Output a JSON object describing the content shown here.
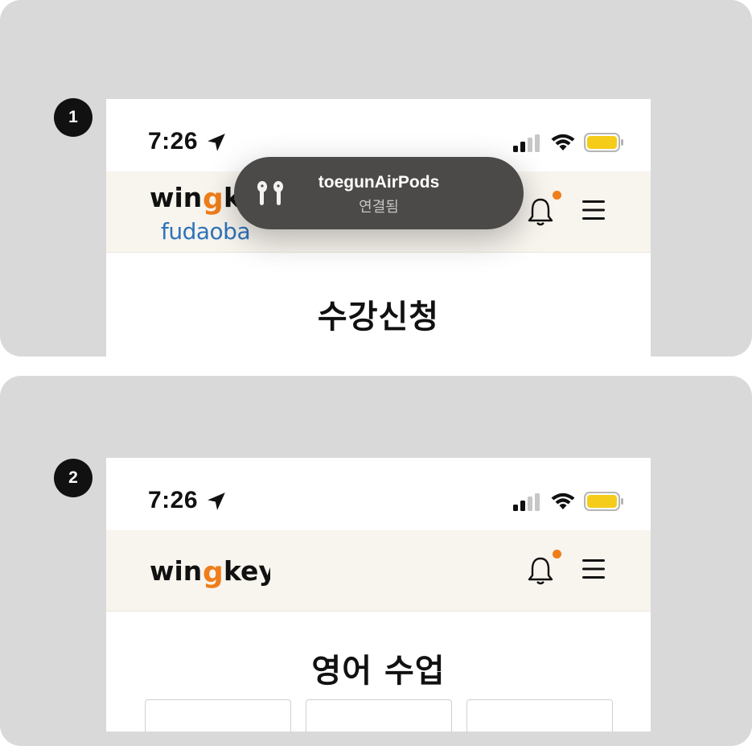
{
  "panel1": {
    "step": "1",
    "status": {
      "time": "7:26"
    },
    "partner_logo": "fudaoba",
    "page_title": "수강신청",
    "popup": {
      "device": "toegunAirPods",
      "status": "연결됨"
    }
  },
  "panel2": {
    "step": "2",
    "status": {
      "time": "7:26"
    },
    "page_title": "영어 수업"
  },
  "brand": {
    "logo_text": "wingkey",
    "accent": "#ef7d1a",
    "header_bg": "#f8f4ee",
    "partner_color": "#2f73b9"
  },
  "icons": [
    "location-arrow-icon",
    "signal-icon",
    "wifi-icon",
    "battery-icon",
    "bell-icon",
    "hamburger-menu-icon",
    "airpods-icon"
  ]
}
